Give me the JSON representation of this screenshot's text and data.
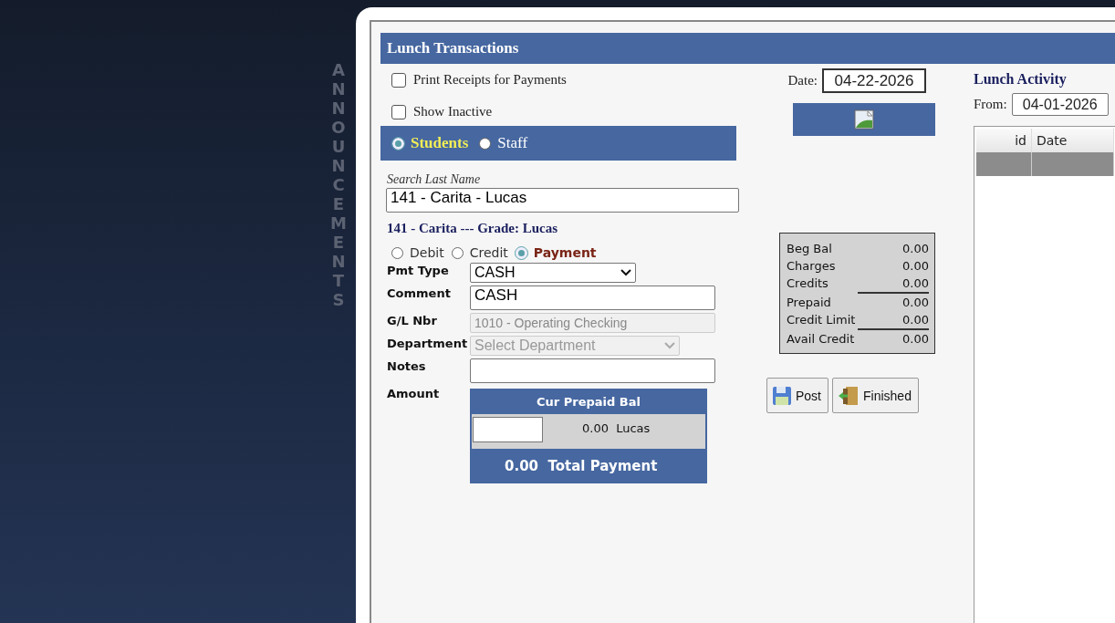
{
  "sidebar": {
    "label": "ANNOUNCEMENTS"
  },
  "dialog": {
    "title": "Lunch Transactions"
  },
  "options": [
    {
      "label": "Print Receipts for Payments",
      "checked": false
    },
    {
      "label": "Show Inactive",
      "checked": false
    }
  ],
  "date": {
    "label": "Date:",
    "value": "04-22-2026"
  },
  "person_types": [
    {
      "label": "Students",
      "selected": true
    },
    {
      "label": "Staff",
      "selected": false
    }
  ],
  "search": {
    "label": "Search Last Name",
    "value": "141 - Carita - Lucas"
  },
  "student_heading": "141 - Carita --- Grade: Lucas",
  "transaction_types": [
    {
      "label": "Debit",
      "selected": false
    },
    {
      "label": "Credit",
      "selected": false
    },
    {
      "label": "Payment",
      "selected": true
    }
  ],
  "form": [
    {
      "kind": "select",
      "label": "Pmt Type",
      "value": "CASH"
    },
    {
      "kind": "text",
      "label": "Comment",
      "value": "CASH"
    },
    {
      "kind": "readonly",
      "label": "G/L Nbr",
      "value": "1010 - Operating Checking"
    },
    {
      "kind": "disabled-select",
      "label": "Department",
      "placeholder": "Select Department"
    },
    {
      "kind": "text",
      "label": "Notes"
    }
  ],
  "amount": {
    "label": "Amount",
    "header": "Cur Prepaid Bal",
    "balance": "0.00",
    "name": "Lucas",
    "total": "0.00",
    "total_label": "Total Payment"
  },
  "summary": [
    {
      "label": "Beg Bal",
      "value": "0.00",
      "rule_after": false
    },
    {
      "label": "Charges",
      "value": "0.00",
      "rule_after": false
    },
    {
      "label": "Credits",
      "value": "0.00",
      "rule_after": true
    },
    {
      "label": "Prepaid",
      "value": "0.00",
      "rule_after": false
    },
    {
      "label": "Credit Limit",
      "value": "0.00",
      "rule_after": true
    },
    {
      "label": "Avail Credit",
      "value": "0.00",
      "rule_after": false
    }
  ],
  "buttons": [
    {
      "kind": "save",
      "label": "Post"
    },
    {
      "kind": "exit",
      "label": "Finished"
    }
  ],
  "activity": {
    "title": "Lunch Activity",
    "from_label": "From:",
    "from": "04-01-2026",
    "columns": [
      "id",
      "Date"
    ]
  }
}
